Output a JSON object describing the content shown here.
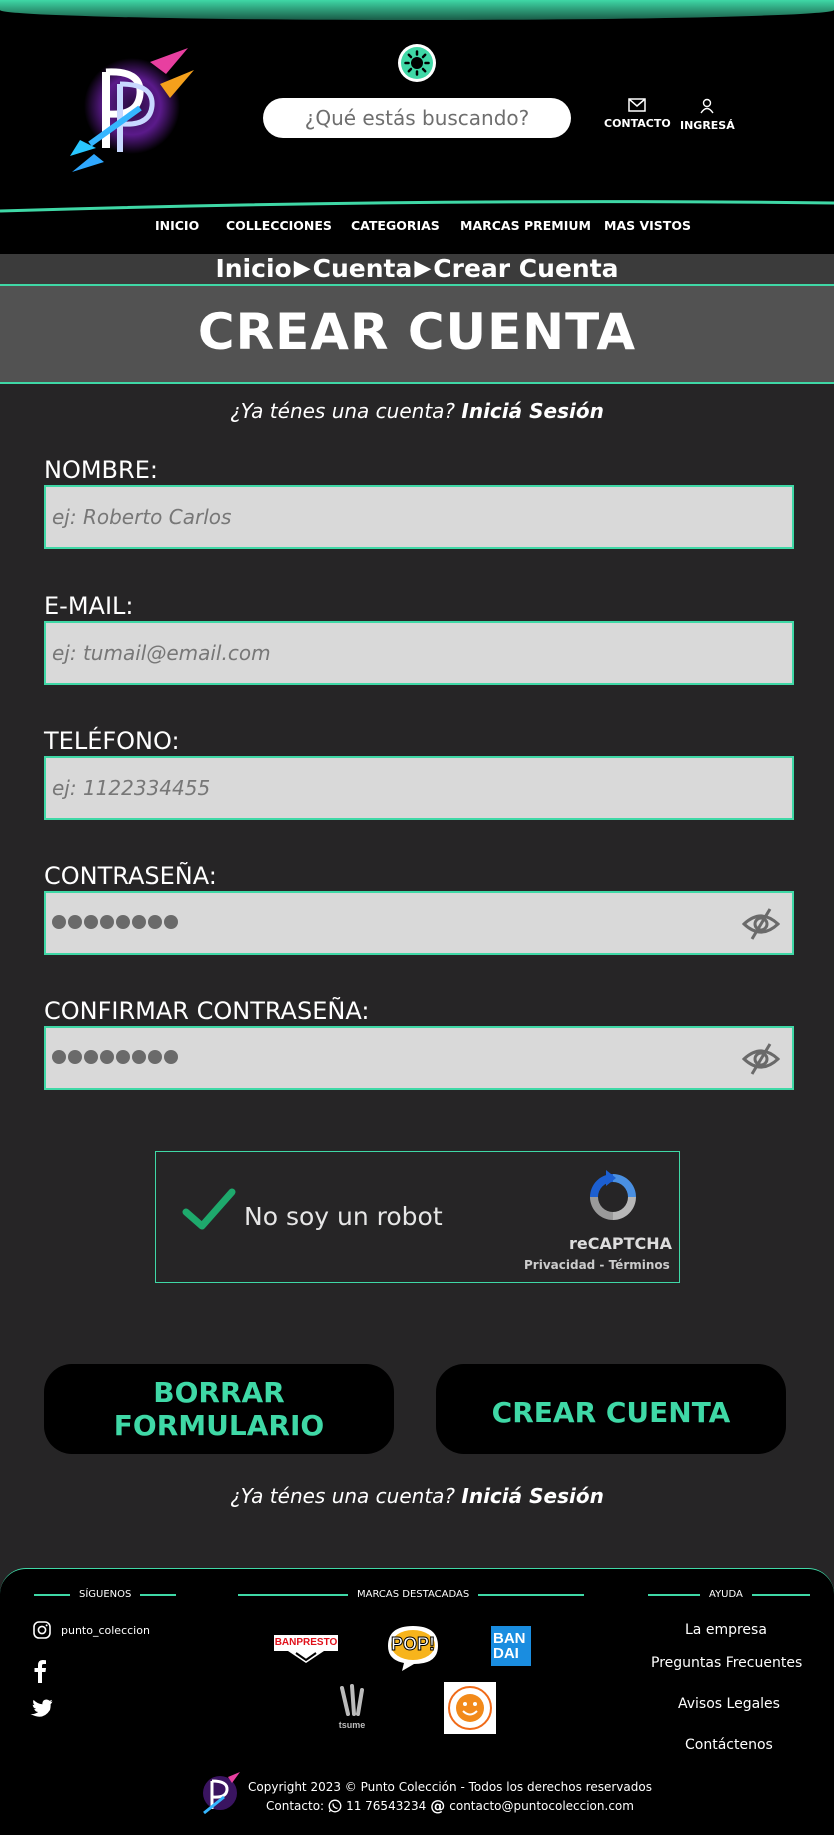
{
  "header": {
    "search_placeholder": "¿Qué estás buscando?",
    "contact_label": "CONTACTO",
    "login_label": "INGRESÁ",
    "logo_text": "PUNTO COLECCIÓN",
    "accent_color": "#3fd8a6"
  },
  "nav": {
    "items": [
      {
        "label": "INICIO"
      },
      {
        "label": "COLLECCIONES"
      },
      {
        "label": "CATEGORIAS"
      },
      {
        "label": "MARCAS PREMIUM"
      },
      {
        "label": "MAS VISTOS"
      }
    ]
  },
  "breadcrumb": {
    "items": [
      "Inicio",
      "Cuenta",
      "Crear Cuenta"
    ],
    "separator": "▶"
  },
  "page": {
    "title": "CREAR CUENTA",
    "have_account": "¿Ya ténes una cuenta?",
    "login_link": "Iniciá Sesión"
  },
  "form": {
    "name_label": "NOMBRE:",
    "name_placeholder": "ej: Roberto Carlos",
    "email_label": "E-MAIL:",
    "email_placeholder": "ej: tumail@email.com",
    "phone_label": "TELÉFONO:",
    "phone_placeholder": "ej: 1122334455",
    "password_label": "CONTRASEÑA:",
    "confirm_label": "CONFIRMAR CONTRASEÑA:",
    "captcha_text": "No soy un robot",
    "captcha_brand": "reCAPTCHA",
    "captcha_terms": "Privacidad - Términos",
    "clear_button": "BORRAR FORMULARIO",
    "submit_button": "CREAR CUENTA"
  },
  "footer": {
    "follow_heading": "SÍGUENOS",
    "instagram_handle": "punto_coleccion",
    "brands_heading": "MARCAS DESTACADAS",
    "brands": [
      "BANPRESTO",
      "POP!",
      "BANDAI",
      "tsume",
      "GOOD SMILE COMPANY"
    ],
    "help_heading": "AYUDA",
    "help_links": [
      "La empresa",
      "Preguntas  Frecuentes",
      "Avisos Legales",
      "Contáctenos"
    ],
    "copyright": "Copyright 2023 © Punto Colección - Todos los derechos reservados",
    "contact_prefix": "Contacto:",
    "phone": "11 76543234",
    "email": "contacto@puntocoleccion.com"
  }
}
